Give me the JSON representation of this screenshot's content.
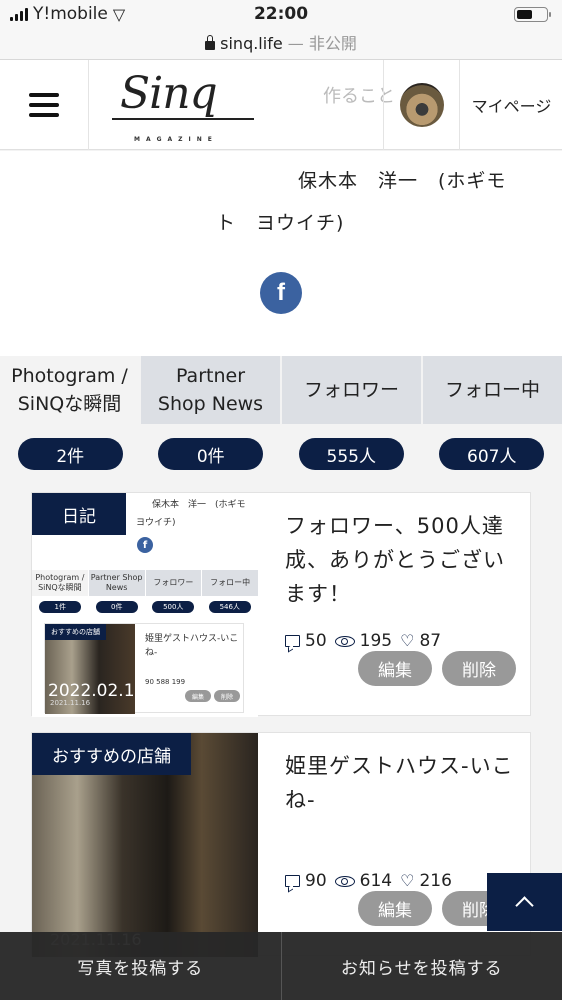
{
  "status_bar": {
    "carrier": "Y!mobile",
    "time": "22:00",
    "url": "sinq.life",
    "url_suffix": "— 非公開"
  },
  "header": {
    "logo_text": "Sinq",
    "logo_sub": "MAGAZINE",
    "ghost_text": "作ること",
    "mypage_label": "マイページ"
  },
  "profile": {
    "name_line1": "保木本　洋一　(ホギモ",
    "name_line2": "ト　ヨウイチ)",
    "facebook_icon": "f"
  },
  "tabs": [
    {
      "label_line1": "Photogram /",
      "label_line2": "SiNQな瞬間",
      "count": "2件",
      "active": true
    },
    {
      "label_line1": "Partner",
      "label_line2": "Shop News",
      "count": "0件",
      "active": false
    },
    {
      "label_line1": "フォロワー",
      "label_line2": "",
      "count": "555人",
      "active": false
    },
    {
      "label_line1": "フォロー中",
      "label_line2": "",
      "count": "607人",
      "active": false
    }
  ],
  "posts": [
    {
      "category": "日記",
      "title": "フォロワー、500人達成、ありがとうございます！",
      "comments": "50",
      "views": "195",
      "likes": "87",
      "edit_label": "編集",
      "delete_label": "削除",
      "thumbnail_preview": {
        "name_line1": "保木本　洋一　(ホギモ",
        "name_line2": "ヨウイチ)",
        "tabs": [
          "Photogram / SiNQな瞬間",
          "Partner Shop News",
          "フォロワー",
          "フォロー中"
        ],
        "counts": [
          "1件",
          "0件",
          "500人",
          "546人"
        ],
        "card_category": "おすすめの店舗",
        "card_title": "姫里ゲストハウス-いこね-",
        "card_stats": "90  588  199",
        "card_btn1": "編集",
        "card_btn2": "削除",
        "overlay_date": "2022.02.1",
        "small_date": "2021.11.16"
      }
    },
    {
      "category": "おすすめの店舗",
      "title": "姫里ゲストハウス-いこね-",
      "date": "2021.11.16",
      "comments": "90",
      "views": "614",
      "likes": "216",
      "edit_label": "編集",
      "delete_label": "削除"
    }
  ],
  "bottom_bar": {
    "post_photo": "写真を投稿する",
    "post_news": "お知らせを投稿する"
  },
  "colors": {
    "navy": "#0c1f45",
    "facebook": "#3b62a0",
    "tab_bg": "#dcdfe4",
    "button_gray": "#999999"
  }
}
